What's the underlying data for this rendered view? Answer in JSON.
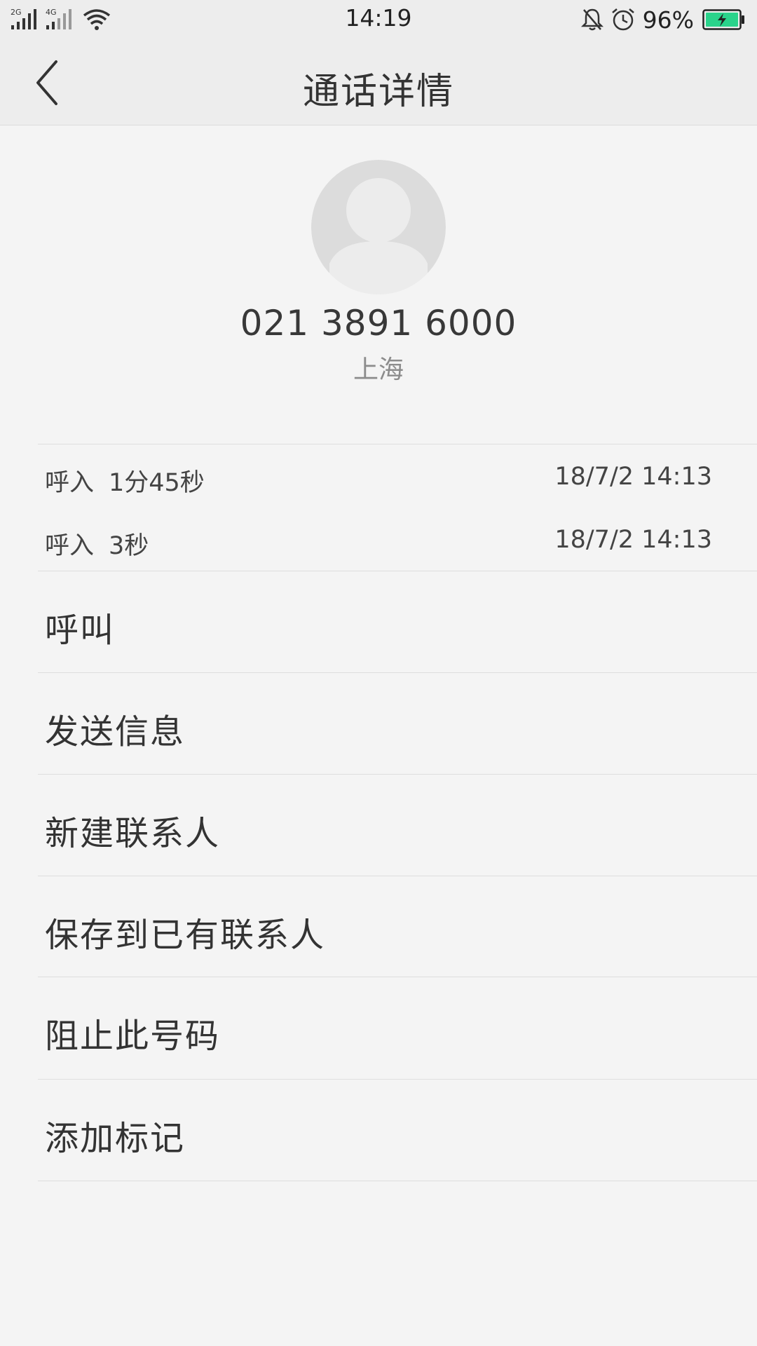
{
  "status_bar": {
    "signal1_label": "2G",
    "signal2_label": "4G",
    "time": "14:19",
    "battery_percent": "96%",
    "battery_color": "#2ad38b",
    "icons": [
      "signal-icon",
      "wifi-icon",
      "bell-muted-icon",
      "alarm-icon",
      "battery-charging-icon"
    ]
  },
  "header": {
    "title": "通话详情",
    "back_icon": "chevron-left-icon"
  },
  "contact": {
    "number": "021 3891 6000",
    "location": "上海"
  },
  "call_log": [
    {
      "type": "呼入",
      "duration": "1分45秒",
      "datetime": "18/7/2 14:13"
    },
    {
      "type": "呼入",
      "duration": "3秒",
      "datetime": "18/7/2 14:13"
    }
  ],
  "actions": [
    {
      "label": "呼叫"
    },
    {
      "label": "发送信息"
    },
    {
      "label": "新建联系人"
    },
    {
      "label": "保存到已有联系人"
    },
    {
      "label": "阻止此号码"
    },
    {
      "label": "添加标记"
    }
  ]
}
